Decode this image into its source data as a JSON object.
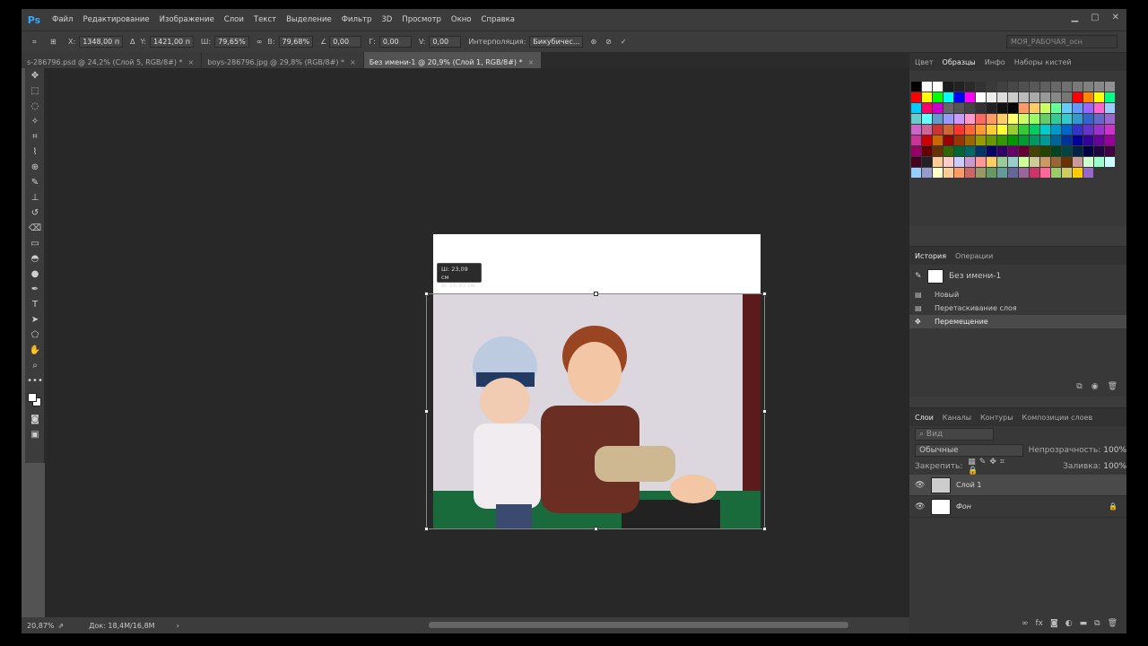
{
  "app": {
    "logo": "Ps"
  },
  "menu": [
    "Файл",
    "Редактирование",
    "Изображение",
    "Слои",
    "Текст",
    "Выделение",
    "Фильтр",
    "3D",
    "Просмотр",
    "Окно",
    "Справка"
  ],
  "options": {
    "x_label": "X:",
    "x_value": "1348,00 п",
    "y_label": "Y:",
    "y_value": "1421,00 п",
    "w_label": "Ш:",
    "w_value": "79,65%",
    "h_label": "В:",
    "h_value": "79,68%",
    "angle_value": "0,00",
    "g_label": "Г:",
    "g_value": "0,00",
    "v_label": "V:",
    "v_value": "0,00",
    "interp_label": "Интерполяция:",
    "interp_value": "Бикубичес...",
    "workspace": "МОЯ_РАБОЧАЯ_осн"
  },
  "tabs": [
    {
      "label": "s-286796.psd @ 24,2% (Слой 5, RGB/8#) *"
    },
    {
      "label": "boys-286796.jpg @ 29,8% (RGB/8#) *"
    },
    {
      "label": "Без имени-1 @ 20,9% (Слой 1, RGB/8#) *"
    }
  ],
  "tooltip": {
    "w": "Ш: 23,09 см",
    "h": "В: 15,93 см"
  },
  "status": {
    "zoom": "20,87%",
    "doc": "Док: 18,4M/16,8M"
  },
  "swatches_panel": {
    "tabs": [
      "Цвет",
      "Образцы",
      "Инфо",
      "Наборы кистей"
    ],
    "active": 1
  },
  "swatches": [
    "#000000",
    "#ffffff",
    "#ffffff",
    "#1a1a1a",
    "#222222",
    "#2a2a2a",
    "#333333",
    "#3a3a3a",
    "#414141",
    "#484848",
    "#505050",
    "#585858",
    "#606060",
    "#686868",
    "#707070",
    "#787878",
    "#808080",
    "#888888",
    "#909090",
    "#ff0000",
    "#ffff00",
    "#00ff00",
    "#00ffff",
    "#0000ff",
    "#ff00ff",
    "#ffffff",
    "#eeeeee",
    "#dddddd",
    "#cccccc",
    "#bbbbbb",
    "#aaaaaa",
    "#999999",
    "#888888",
    "#777777",
    "#ff0000",
    "#ff8800",
    "#ffff00",
    "#00ff88",
    "#00ccff",
    "#ff0066",
    "#cc00cc",
    "#666666",
    "#555555",
    "#444444",
    "#333333",
    "#222222",
    "#111111",
    "#000000",
    "#ff9966",
    "#ffcc66",
    "#ccff66",
    "#66ff99",
    "#66ccff",
    "#6699ff",
    "#9966ff",
    "#ff66cc",
    "#99ccff",
    "#66cccc",
    "#66ffff",
    "#6699cc",
    "#9999ff",
    "#cc99ff",
    "#ff99cc",
    "#ff6666",
    "#ff9966",
    "#ffcc66",
    "#ffff66",
    "#ccff66",
    "#99ff66",
    "#66cc66",
    "#33cc99",
    "#33cccc",
    "#3399cc",
    "#3366cc",
    "#6666cc",
    "#9966cc",
    "#cc66cc",
    "#cc6699",
    "#cc3333",
    "#cc6633",
    "#ff3333",
    "#ff6633",
    "#ff9933",
    "#ffcc33",
    "#ffff33",
    "#99cc33",
    "#33cc33",
    "#00cc66",
    "#00cccc",
    "#0099cc",
    "#0066cc",
    "#3333cc",
    "#6633cc",
    "#9933cc",
    "#cc33cc",
    "#cc3399",
    "#cc0000",
    "#cc6600",
    "#990000",
    "#993300",
    "#996600",
    "#999900",
    "#669900",
    "#339900",
    "#009900",
    "#009933",
    "#009966",
    "#009999",
    "#006699",
    "#003399",
    "#000099",
    "#330099",
    "#660099",
    "#990099",
    "#990066",
    "#660000",
    "#663300",
    "#336600",
    "#006633",
    "#006666",
    "#003366",
    "#000066",
    "#330066",
    "#660066",
    "#660033",
    "#444400",
    "#224400",
    "#004422",
    "#004444",
    "#002244",
    "#000044",
    "#220044",
    "#440044",
    "#440022",
    "#222222",
    "#ffcc99",
    "#ffcccc",
    "#ccccff",
    "#cc99cc",
    "#ff9999",
    "#ffcc66",
    "#99cc99",
    "#99cccc",
    "#ccff99",
    "#cccc99",
    "#cc9966",
    "#996633",
    "#663300",
    "#cc9999",
    "#ccffcc",
    "#99ffcc",
    "#ccffff",
    "#99ccff",
    "#9999cc",
    "#ffffcc",
    "#ffcc99",
    "#ff9966",
    "#cc6666",
    "#999966",
    "#669966",
    "#669999",
    "#666699",
    "#996699",
    "#cc3366",
    "#ff6699",
    "#99cc66",
    "#cccc66",
    "#ffcc00",
    "#9966cc"
  ],
  "history_panel": {
    "tabs": [
      "История",
      "Операции"
    ],
    "active": 0,
    "snapshot": "Без имени-1",
    "items": [
      "Новый",
      "Перетаскивание слоя",
      "Перемещение"
    ]
  },
  "layers_panel": {
    "tabs": [
      "Слои",
      "Каналы",
      "Контуры",
      "Композиции слоев"
    ],
    "active": 0,
    "filter": "Вид",
    "blend": "Обычные",
    "opacity_label": "Непрозрачность:",
    "opacity": "100%",
    "lock_label": "Закрепить:",
    "fill_label": "Заливка:",
    "fill": "100%",
    "layers": [
      {
        "name": "Слой 1"
      },
      {
        "name": "Фон"
      }
    ]
  }
}
